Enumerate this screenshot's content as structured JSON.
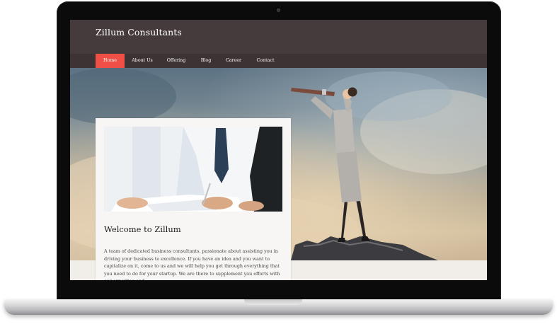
{
  "site": {
    "title": "Zillum Consultants"
  },
  "nav": {
    "items": [
      {
        "label": "Home",
        "active": true
      },
      {
        "label": "About Us",
        "active": false
      },
      {
        "label": "Offering",
        "active": false
      },
      {
        "label": "Blog",
        "active": false
      },
      {
        "label": "Career",
        "active": false
      },
      {
        "label": "Contact",
        "active": false
      }
    ]
  },
  "card": {
    "title": "Welcome to Zillum",
    "text": "A team of dedicated business consultants, passionate about assisting you in driving your business to excellence. If you have an idea and you want to capitalize on it, come to us and we will help you get through everything that you need to do for your startup. We are there to supplement you efforts with our expertise and"
  },
  "colors": {
    "header": "#463b3c",
    "nav": "#3d3334",
    "accent": "#ef4f45"
  },
  "icons": {
    "camera": "webcam-icon"
  }
}
